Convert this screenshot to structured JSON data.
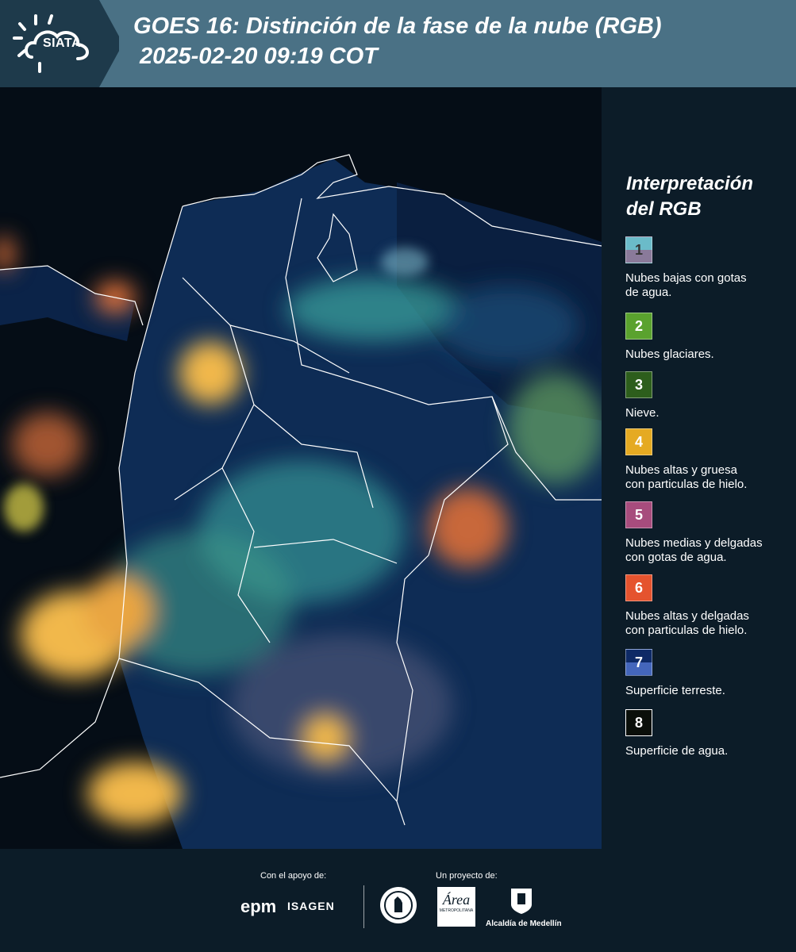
{
  "header": {
    "logo_text": "SIATA",
    "title_line1": "GOES 16: Distinción de la fase de la nube (RGB)",
    "title_line2": " 2025-02-20 09:19 COT"
  },
  "map": {
    "type": "satellite composite",
    "background_color": "#061523",
    "border_color": "#ffffff",
    "colors": {
      "ocean": "#050d16",
      "land": "#0e2c55",
      "cloud_low": "#3aa7a0",
      "cloud_glacial": "#7fc86a",
      "cloud_high_thick": "#f1b84b",
      "cloud_high_thin": "#e4733a"
    }
  },
  "legend": {
    "title_line1": "Interpretación",
    "title_line2": "del RGB",
    "items": [
      {
        "number": "1",
        "label_line1": "Nubes bajas con gotas",
        "label_line2": "de agua.",
        "color_top": "#6bbbc9",
        "color_bottom": "#8a7a9a",
        "number_color": "#333333"
      },
      {
        "number": "2",
        "label_line1": "Nubes glaciares.",
        "label_line2": "",
        "color_top": "#5aa22e",
        "color_bottom": "#5aa22e",
        "number_color": "#ffffff"
      },
      {
        "number": "3",
        "label_line1": "Nieve.",
        "label_line2": "",
        "color_top": "#2d5e1c",
        "color_bottom": "#2d5e1c",
        "number_color": "#ffffff"
      },
      {
        "number": "4",
        "label_line1": "Nubes altas y gruesa",
        "label_line2": "con particulas de hielo.",
        "color_top": "#e5aa22",
        "color_bottom": "#e5aa22",
        "number_color": "#ffffff"
      },
      {
        "number": "5",
        "label_line1": "Nubes medias y delgadas",
        "label_line2": "con gotas de agua.",
        "color_top": "#a74c7d",
        "color_bottom": "#a74c7d",
        "number_color": "#ffffff"
      },
      {
        "number": "6",
        "label_line1": "Nubes altas y delgadas",
        "label_line2": "con particulas de hielo.",
        "color_top": "#e5532e",
        "color_bottom": "#e5532e",
        "number_color": "#ffffff"
      },
      {
        "number": "7",
        "label_line1": "Superficie terreste.",
        "label_line2": "",
        "color_top": "#0e2a66",
        "color_bottom": "#4466bb",
        "number_color": "#ffffff"
      },
      {
        "number": "8",
        "label_line1": "Superficie de agua.",
        "label_line2": "",
        "color_top": "#0a0f0a",
        "color_bottom": "#0a0f0a",
        "number_color": "#ffffff"
      }
    ]
  },
  "footer": {
    "support_label": "Con el apoyo de:",
    "project_label": "Un proyecto de:",
    "epm_logo": "epm",
    "isagen_logo": "ISAGEN",
    "metro_logo_text": "Área",
    "metro_logo_sub": "METROPOLITANA",
    "alcaldia_label": "Alcaldía de Medellín"
  }
}
